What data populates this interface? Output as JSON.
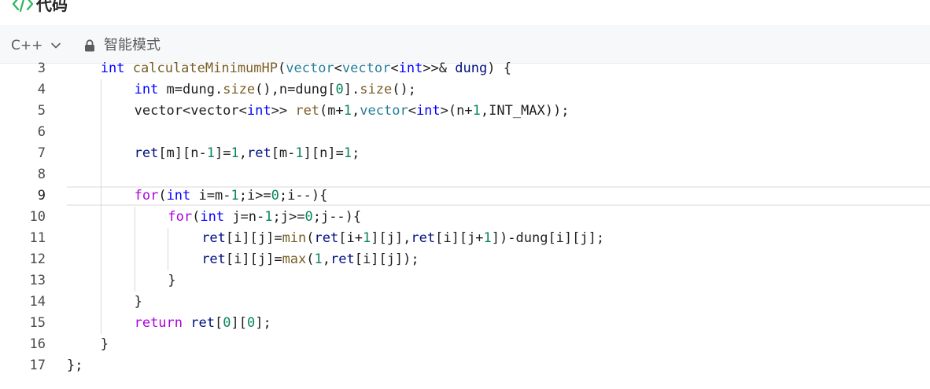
{
  "header": {
    "title": "代码",
    "icon": "code-icon"
  },
  "toolbar": {
    "language": "C++",
    "mode_label": "智能模式"
  },
  "colors": {
    "keyword": "#0000ff",
    "control": "#af00db",
    "function": "#795e26",
    "number": "#098658",
    "type": "#267f99",
    "variable": "#001080",
    "plain": "#1f1f1f",
    "accent_icon": "#2db55d"
  },
  "editor": {
    "active_line": 9,
    "lines": [
      {
        "number": "3",
        "indent": 1,
        "tokens": [
          {
            "t": "int",
            "c": "kw"
          },
          {
            "t": " ",
            "c": "plain"
          },
          {
            "t": "calculateMinimumHP",
            "c": "fn"
          },
          {
            "t": "(",
            "c": "plain"
          },
          {
            "t": "vector",
            "c": "type"
          },
          {
            "t": "<",
            "c": "plain"
          },
          {
            "t": "vector",
            "c": "type"
          },
          {
            "t": "<",
            "c": "plain"
          },
          {
            "t": "int",
            "c": "kw"
          },
          {
            "t": ">>& ",
            "c": "plain"
          },
          {
            "t": "dung",
            "c": "var"
          },
          {
            "t": ") {",
            "c": "plain"
          }
        ]
      },
      {
        "number": "4",
        "indent": 2,
        "tokens": [
          {
            "t": "int",
            "c": "kw"
          },
          {
            "t": " m=dung.",
            "c": "plain"
          },
          {
            "t": "size",
            "c": "fn"
          },
          {
            "t": "(),n=dung[",
            "c": "plain"
          },
          {
            "t": "0",
            "c": "num"
          },
          {
            "t": "].",
            "c": "plain"
          },
          {
            "t": "size",
            "c": "fn"
          },
          {
            "t": "();",
            "c": "plain"
          }
        ]
      },
      {
        "number": "5",
        "indent": 2,
        "tokens": [
          {
            "t": "vector<vector<",
            "c": "plain"
          },
          {
            "t": "int",
            "c": "kw"
          },
          {
            "t": ">> ",
            "c": "plain"
          },
          {
            "t": "ret",
            "c": "fn"
          },
          {
            "t": "(m+",
            "c": "plain"
          },
          {
            "t": "1",
            "c": "num"
          },
          {
            "t": ",",
            "c": "plain"
          },
          {
            "t": "vector",
            "c": "type"
          },
          {
            "t": "<",
            "c": "plain"
          },
          {
            "t": "int",
            "c": "kw"
          },
          {
            "t": ">(n+",
            "c": "plain"
          },
          {
            "t": "1",
            "c": "num"
          },
          {
            "t": ",INT_MAX));",
            "c": "plain"
          }
        ]
      },
      {
        "number": "6",
        "indent": 2,
        "tokens": []
      },
      {
        "number": "7",
        "indent": 2,
        "tokens": [
          {
            "t": "ret",
            "c": "var"
          },
          {
            "t": "[m][n-",
            "c": "plain"
          },
          {
            "t": "1",
            "c": "num"
          },
          {
            "t": "]=",
            "c": "plain"
          },
          {
            "t": "1",
            "c": "num"
          },
          {
            "t": ",",
            "c": "plain"
          },
          {
            "t": "ret",
            "c": "var"
          },
          {
            "t": "[m-",
            "c": "plain"
          },
          {
            "t": "1",
            "c": "num"
          },
          {
            "t": "][n]=",
            "c": "plain"
          },
          {
            "t": "1",
            "c": "num"
          },
          {
            "t": ";",
            "c": "plain"
          }
        ]
      },
      {
        "number": "8",
        "indent": 2,
        "tokens": []
      },
      {
        "number": "9",
        "indent": 2,
        "tokens": [
          {
            "t": "for",
            "c": "ctl"
          },
          {
            "t": "(",
            "c": "plain"
          },
          {
            "t": "int",
            "c": "kw"
          },
          {
            "t": " i=m-",
            "c": "plain"
          },
          {
            "t": "1",
            "c": "num"
          },
          {
            "t": ";i>=",
            "c": "plain"
          },
          {
            "t": "0",
            "c": "num"
          },
          {
            "t": ";i--){",
            "c": "plain"
          }
        ]
      },
      {
        "number": "10",
        "indent": 3,
        "tokens": [
          {
            "t": "for",
            "c": "ctl"
          },
          {
            "t": "(",
            "c": "plain"
          },
          {
            "t": "int",
            "c": "kw"
          },
          {
            "t": " j=n-",
            "c": "plain"
          },
          {
            "t": "1",
            "c": "num"
          },
          {
            "t": ";j>=",
            "c": "plain"
          },
          {
            "t": "0",
            "c": "num"
          },
          {
            "t": ";j--){",
            "c": "plain"
          }
        ]
      },
      {
        "number": "11",
        "indent": 4,
        "tokens": [
          {
            "t": "ret",
            "c": "var"
          },
          {
            "t": "[i][j]=",
            "c": "plain"
          },
          {
            "t": "min",
            "c": "fn"
          },
          {
            "t": "(",
            "c": "plain"
          },
          {
            "t": "ret",
            "c": "var"
          },
          {
            "t": "[i+",
            "c": "plain"
          },
          {
            "t": "1",
            "c": "num"
          },
          {
            "t": "][j],",
            "c": "plain"
          },
          {
            "t": "ret",
            "c": "var"
          },
          {
            "t": "[i][j+",
            "c": "plain"
          },
          {
            "t": "1",
            "c": "num"
          },
          {
            "t": "])-dung[i][j];",
            "c": "plain"
          }
        ]
      },
      {
        "number": "12",
        "indent": 4,
        "tokens": [
          {
            "t": "ret",
            "c": "var"
          },
          {
            "t": "[i][j]=",
            "c": "plain"
          },
          {
            "t": "max",
            "c": "fn"
          },
          {
            "t": "(",
            "c": "plain"
          },
          {
            "t": "1",
            "c": "num"
          },
          {
            "t": ",",
            "c": "plain"
          },
          {
            "t": "ret",
            "c": "var"
          },
          {
            "t": "[i][j]);",
            "c": "plain"
          }
        ]
      },
      {
        "number": "13",
        "indent": 3,
        "tokens": [
          {
            "t": "}",
            "c": "plain"
          }
        ]
      },
      {
        "number": "14",
        "indent": 2,
        "tokens": [
          {
            "t": "}",
            "c": "plain"
          }
        ]
      },
      {
        "number": "15",
        "indent": 2,
        "tokens": [
          {
            "t": "return",
            "c": "ctl"
          },
          {
            "t": " ",
            "c": "plain"
          },
          {
            "t": "ret",
            "c": "var"
          },
          {
            "t": "[",
            "c": "plain"
          },
          {
            "t": "0",
            "c": "num"
          },
          {
            "t": "][",
            "c": "plain"
          },
          {
            "t": "0",
            "c": "num"
          },
          {
            "t": "];",
            "c": "plain"
          }
        ]
      },
      {
        "number": "16",
        "indent": 1,
        "tokens": [
          {
            "t": "}",
            "c": "plain"
          }
        ]
      },
      {
        "number": "17",
        "indent": 0,
        "tokens": [
          {
            "t": "};",
            "c": "plain"
          }
        ]
      }
    ]
  }
}
